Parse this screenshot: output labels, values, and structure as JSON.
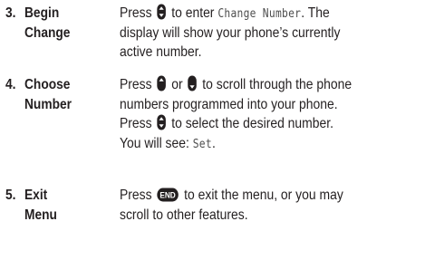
{
  "steps": [
    {
      "number": "3.",
      "title": [
        "Begin",
        "Change"
      ],
      "lines": [
        [
          "Press ",
          {
            "icon": "select-key-icon"
          },
          " to enter ",
          {
            "lcd": "Change Number"
          },
          ". The"
        ],
        [
          "display will show your phone’s currently"
        ],
        [
          "active number."
        ]
      ]
    },
    {
      "number": "4.",
      "title": [
        "Choose",
        "Number"
      ],
      "lines": [
        [
          "Press ",
          {
            "icon": "scroll-up-key-icon"
          },
          " or ",
          {
            "icon": "scroll-down-key-icon"
          },
          " to scroll through the phone"
        ],
        [
          "numbers programmed into your phone."
        ],
        [
          "Press ",
          {
            "icon": "select-key-icon"
          },
          " to select the desired number."
        ],
        [
          "You will see: ",
          {
            "lcd": "Set"
          },
          "."
        ]
      ]
    },
    {
      "number": "5.",
      "title": [
        "Exit",
        "Menu"
      ],
      "lines": [
        [
          "Press ",
          {
            "icon": "end-key-icon"
          },
          " to exit the menu, or you may"
        ],
        [
          "scroll to other features."
        ]
      ]
    }
  ],
  "icons": {
    "end-key-icon": {
      "label": "END"
    }
  },
  "colors": {
    "text": "#231f20",
    "lcd": "#4d4d4d"
  }
}
